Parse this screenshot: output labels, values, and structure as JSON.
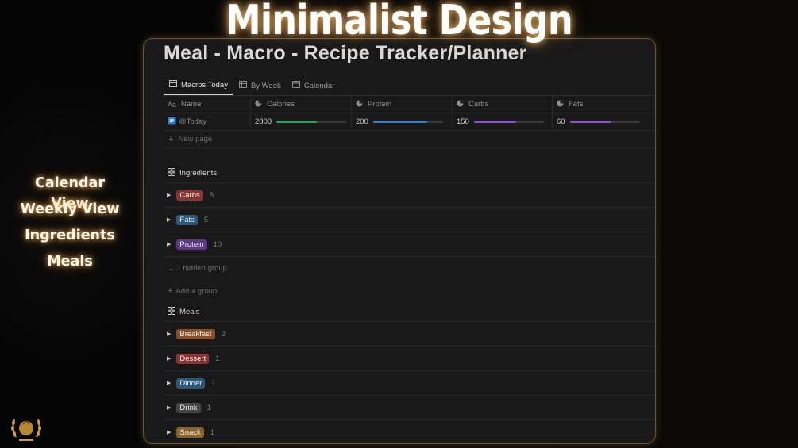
{
  "headline": "Minimalist Design",
  "side_features": [
    "Calendar View",
    "Weekly View",
    "Ingredients",
    "Meals"
  ],
  "page": {
    "title": "Meal - Macro - Recipe Tracker/Planner",
    "tabs": [
      {
        "label": "Macros Today",
        "icon": "table-icon",
        "active": true
      },
      {
        "label": "By Week",
        "icon": "table-icon",
        "active": false
      },
      {
        "label": "Calendar",
        "icon": "calendar-icon",
        "active": false
      }
    ],
    "table": {
      "columns": [
        {
          "label": "Name",
          "icon": "Aa"
        },
        {
          "label": "Calories",
          "icon": "rollup-icon"
        },
        {
          "label": "Protein",
          "icon": "rollup-icon"
        },
        {
          "label": "Carbs",
          "icon": "rollup-icon"
        },
        {
          "label": "Fats",
          "icon": "rollup-icon"
        }
      ],
      "row": {
        "name": "@Today",
        "calories": "2800",
        "calories_progress": 0.58,
        "calories_color": "#2f9e5f",
        "protein": "200",
        "protein_progress": 0.78,
        "protein_color": "#3a7fb8",
        "carbs": "150",
        "carbs_progress": 0.6,
        "carbs_color": "#8d4fc4",
        "fats": "60",
        "fats_progress": 0.6,
        "fats_color": "#8d4fc4"
      },
      "new_page": "New page"
    },
    "ingredients": {
      "title": "Ingredients",
      "groups": [
        {
          "label": "Carbs",
          "count": "8",
          "color": "#8b3434"
        },
        {
          "label": "Fats",
          "count": "5",
          "color": "#2b5878"
        },
        {
          "label": "Protein",
          "count": "10",
          "color": "#5b3784"
        }
      ],
      "hidden": "1 hidden group",
      "add_group": "Add a group"
    },
    "meals": {
      "title": "Meals",
      "groups": [
        {
          "label": "Breakfast",
          "count": "2",
          "color": "#8a4e24"
        },
        {
          "label": "Dessert",
          "count": "1",
          "color": "#8b3434"
        },
        {
          "label": "Dinner",
          "count": "1",
          "color": "#2b5878"
        },
        {
          "label": "Drink",
          "count": "1",
          "color": "#454545"
        },
        {
          "label": "Snack",
          "count": "1",
          "color": "#8a6424"
        }
      ]
    }
  }
}
